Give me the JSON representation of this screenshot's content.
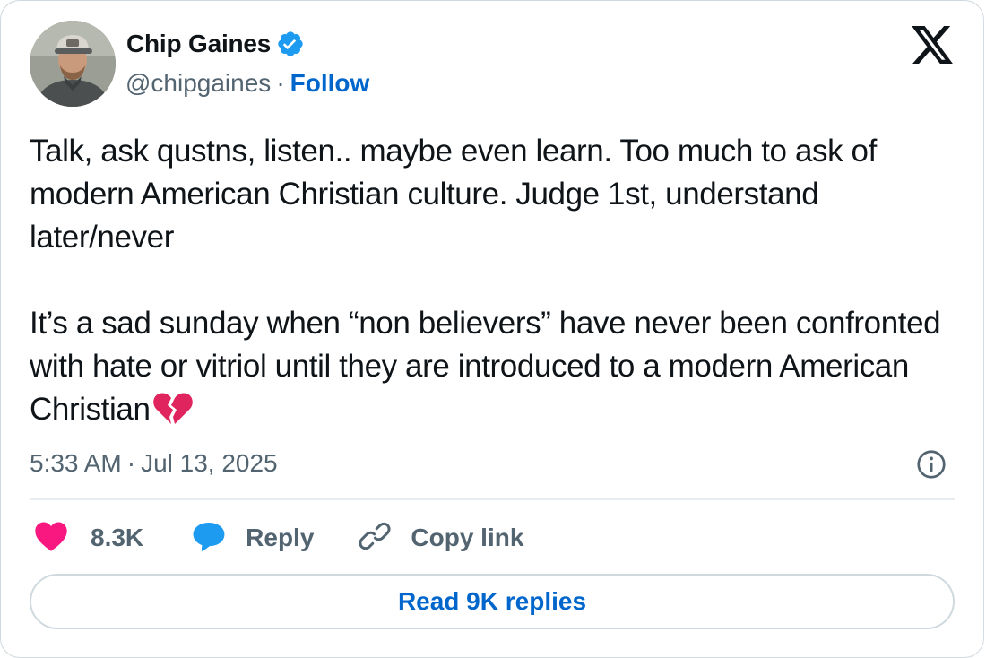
{
  "author": {
    "name": "Chip Gaines",
    "handle": "@chipgaines",
    "separator": "·",
    "follow_label": "Follow",
    "verified": true
  },
  "tweet": {
    "text": "Talk, ask qustns, listen.. maybe even learn. Too much to ask of modern American Christian culture. Judge 1st, understand later/never\n\nIt’s a sad sunday when “non believers” have never been confronted with hate or vitriol until they are introduced to a modern American Christian",
    "trailing_emoji": "broken-heart",
    "time": "5:33 AM",
    "date_separator": "·",
    "date": "Jul 13, 2025"
  },
  "actions": {
    "like_count": "8.3K",
    "reply_label": "Reply",
    "copy_link_label": "Copy link"
  },
  "read_replies_label": "Read 9K replies",
  "icons": {
    "platform_logo": "x-logo-icon",
    "verified": "verified-badge-icon",
    "info": "info-icon",
    "like": "heart-icon",
    "reply": "speech-bubble-icon",
    "copy": "link-icon"
  },
  "colors": {
    "link": "#0066cc",
    "secondary_text": "#536471",
    "like": "#f91880",
    "reply": "#1d9bf0",
    "verified": "#1d9bf0",
    "broken_heart": "#e0245e"
  }
}
